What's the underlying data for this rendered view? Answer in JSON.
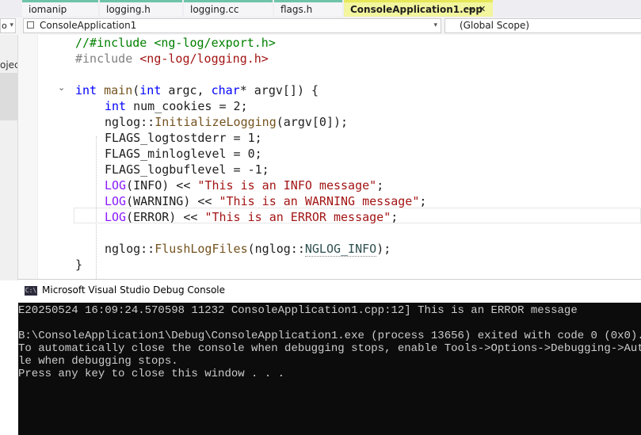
{
  "tabs": [
    {
      "label": "iomanip"
    },
    {
      "label": "logging.h"
    },
    {
      "label": "logging.cc"
    },
    {
      "label": "flags.h"
    },
    {
      "label": "ConsoleApplication1.cpp",
      "pin": "⊸",
      "close": "✕"
    }
  ],
  "navbar": {
    "project": "ConsoleApplication1",
    "scope": "(Global Scope)",
    "left_arrow": "▾"
  },
  "leftstrip": {
    "label_top": "o",
    "label_mid": "ojec"
  },
  "code": {
    "l1_a": "//#include <ng-log/export.h>",
    "l2_a": "#include ",
    "l2_b": "<ng-log/logging.h>",
    "l4_int": "int",
    "l4_main": "main",
    "l4_open": "(",
    "l4_int2": "int",
    "l4_argc": " argc, ",
    "l4_char": "char",
    "l4_rest": "* argv[]) {",
    "l5_int": "int",
    "l5_rest": " num_cookies = 2;",
    "l6_ns": "nglog::",
    "l6_fn": "InitializeLogging",
    "l6_rest": "(argv[0]);",
    "l7": "FLAGS_logtostderr = 1;",
    "l8": "FLAGS_minloglevel = 0;",
    "l9": "FLAGS_logbuflevel = -1;",
    "l10_mac": "LOG",
    "l10_mid": "(INFO) << ",
    "l10_str": "\"This is an INFO message\"",
    "l10_end": ";",
    "l11_mac": "LOG",
    "l11_mid": "(WARNING) << ",
    "l11_str": "\"This is an WARNING message\"",
    "l11_end": ";",
    "l12_mac": "LOG",
    "l12_mid": "(ERROR) << ",
    "l12_str": "\"This is an ERROR message\"",
    "l12_end": ";",
    "l14_ns": "nglog::",
    "l14_fn": "FlushLogFiles",
    "l14_mid": "(nglog::",
    "l14_enum": "NGLOG_INFO",
    "l14_end": ");",
    "l15": "}"
  },
  "console": {
    "title": "Microsoft Visual Studio Debug Console",
    "icon": "C:\\",
    "lines": [
      "E20250524 16:09:24.570598 11232 ConsoleApplication1.cpp:12] This is an ERROR message",
      "",
      "B:\\ConsoleApplication1\\Debug\\ConsoleApplication1.exe (process 13656) exited with code 0 (0x0).",
      "To automatically close the console when debugging stops, enable Tools->Options->Debugging->Automati",
      "le when debugging stops.",
      "Press any key to close this window . . ."
    ]
  },
  "colors": {
    "active_tab": "#f3f59f",
    "tab_accent": "#6fc3a8",
    "keyword": "#0000ff",
    "string": "#a31515",
    "macro": "#8a1bff",
    "function": "#74531f",
    "console_bg": "#0c0c0c"
  }
}
